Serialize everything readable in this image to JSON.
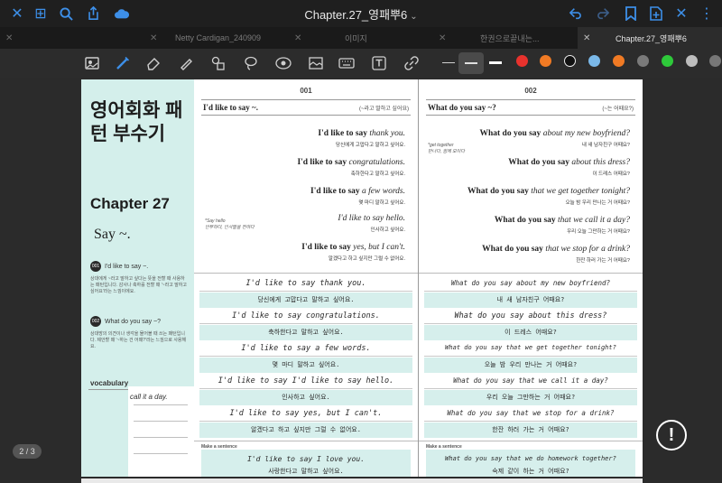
{
  "window": {
    "title": "Chapter.27_영패뿌6",
    "title_chevron": "⌄"
  },
  "titlebar_icons": {
    "close": "✕",
    "grid": "⊞",
    "search": "🔍",
    "share": "⬆",
    "cloud": "☁",
    "undo": "↶",
    "redo": "↷",
    "bookmark": "🔖",
    "add_page": "⊕",
    "close_window": "✕",
    "more": "⋮"
  },
  "tabs": [
    {
      "label": "Netty Cardigan_240909"
    },
    {
      "label": "이미지"
    },
    {
      "label": "한권으로끝내는..."
    },
    {
      "label": "Chapter.27_영패뿌6"
    }
  ],
  "toolbar": {
    "icons": [
      "scan-icon",
      "pen-icon",
      "eraser-icon",
      "highlighter-icon",
      "shapes-icon",
      "lasso-icon",
      "laser-icon",
      "image-icon",
      "keyboard-icon",
      "text-icon",
      "link-icon"
    ],
    "colors": [
      "#ffffff",
      "#e8322d",
      "#f07a24",
      "#111111",
      "#7ab8e8",
      "#f07a24",
      "#7a7a7a",
      "#2ec93a",
      "#bdbdbd"
    ]
  },
  "sidebar": {
    "title": "영어회화 패턴 부수기",
    "chapter": "Chapter 27",
    "say": "Say ~.",
    "pattern1_num": "001",
    "pattern1": "I'd like to say ~.",
    "pattern1_desc": "상대에게 ~라고 말하고 싶다는 뜻을 전할 때 사용하는 패턴입니다. 감사나 축하를 전할 때 '~라고 말하고 싶어요'라는 느낌이에요.",
    "pattern2_num": "002",
    "pattern2": "What do you say ~?",
    "pattern2_desc": "상대방의 의견이나 생각을 물어볼 때 쓰는 패턴입니다. 제안할 때 '~하는 건 어때?'라는 느낌으로 사용해요.",
    "vocab_label": "vocabulary",
    "vocab_hw": "call it a day."
  },
  "col1": {
    "num": "001",
    "head": "I'd like to say ~.",
    "head_ko": "(~라고 말하고 싶어요)",
    "sentences": [
      {
        "main": "I'd like to say ",
        "em": "thank you.",
        "ko": "당신에게 고맙다고 말하고 싶어요."
      },
      {
        "main": "I'd like to say ",
        "em": "congratulations.",
        "ko": "축하한다고 말하고 싶어요."
      },
      {
        "main": "I'd like to say ",
        "em": "a few words.",
        "ko": "몇 마디 말하고 싶어요."
      },
      {
        "main": "I'd like to say ",
        "em": "I'd like to say hello.",
        "ko": "인사하고 싶어요."
      },
      {
        "main": "I'd like to say ",
        "em": "yes, but I can't.",
        "ko": "알겠다고 하고 싶지만 그럴 수 없어요."
      }
    ],
    "note": "*Say hello\n안부하다, 인사말을 전하다",
    "practice": [
      "I'd like to say thank you.",
      "당신에게 고맙다고 말하고 싶어요.",
      "I'd like to say congratulations.",
      "축하한다고 말하고 싶어요.",
      "I'd like to say a few words.",
      "몇 마디 말하고 싶어요.",
      "I'd like to say I'd like to say hello.",
      "인사하고 싶어요.",
      "I'd like to say yes, but I can't.",
      "알겠다고 하고 싶지만 그럴 수 없어요."
    ],
    "make_label": "Make a sentence",
    "make_text": "I'd like to say I love you.",
    "make_text_ko": "사랑한다고 말하고 싶어요."
  },
  "col2": {
    "num": "002",
    "head": "What do you say ~?",
    "head_ko": "(~는 어때요?)",
    "sentences": [
      {
        "main": "What do you say ",
        "em": "about my new boyfriend?",
        "ko": "내 새 남자친구 어때요?"
      },
      {
        "main": "What do you say ",
        "em": "about this dress?",
        "ko": "이 드레스 어때요?"
      },
      {
        "main": "What do you say ",
        "em": "that we get together tonight?",
        "ko": "오늘 밤 우리 만나는 거 어때요?"
      },
      {
        "main": "What do you say ",
        "em": "that we call it a day?",
        "ko": "우리 오늘 그만하는 거 어때요?"
      },
      {
        "main": "What do you say ",
        "em": "that we stop for a drink?",
        "ko": "한잔 하러 가는 거 어때요?"
      }
    ],
    "note": "*get together\n만나다, 함께 모이다",
    "practice": [
      "What do you say about my new boyfriend?",
      "내 새 남자친구 어때요?",
      "What do you say about this dress?",
      "이 드레스 어때요?",
      "What do you say that we get together tonight?",
      "오늘 밤 우리 만나는 거 어때요?",
      "What do you say that we call it a day?",
      "우리 오늘 그만하는 거 어때요?",
      "What do you say that we stop for a drink?",
      "한잔 하러 가는 거 어때요?"
    ],
    "make_label": "Make a sentence",
    "make_text": "What do you say that we do homework together?",
    "make_text_ko": "숙제 같이 하는 거 어때요?"
  },
  "page_indicator": "2 / 3",
  "info_button": "!"
}
